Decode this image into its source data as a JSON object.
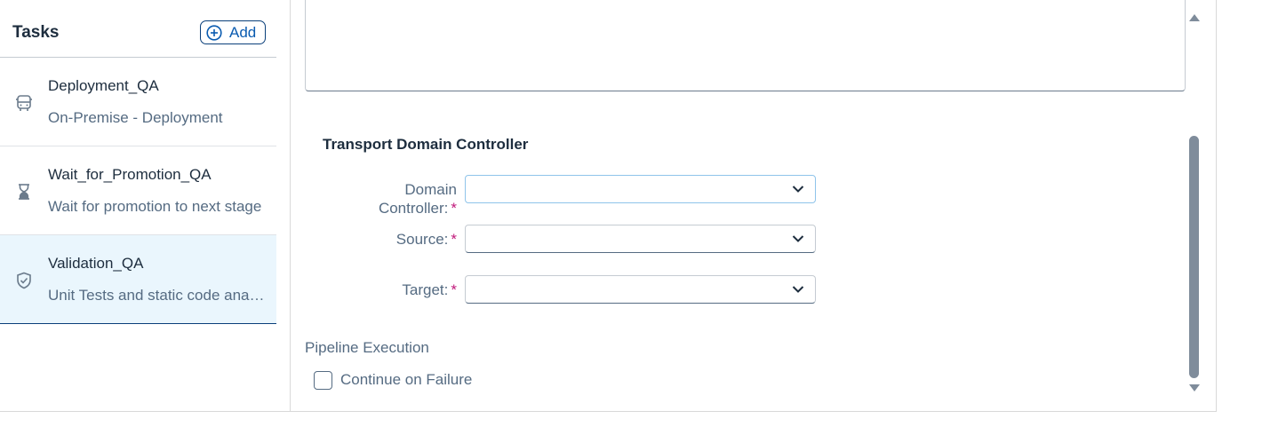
{
  "sidebar": {
    "title": "Tasks",
    "add_label": "Add",
    "tasks": [
      {
        "name": "Deployment_QA",
        "description": "On-Premise - Deployment",
        "icon": "bus-icon"
      },
      {
        "name": "Wait_for_Promotion_QA",
        "description": "Wait for promotion to next stage",
        "icon": "hourglass-icon"
      },
      {
        "name": "Validation_QA",
        "description": "Unit Tests and static code analysis",
        "icon": "shield-check-icon"
      }
    ],
    "selected_index": 2
  },
  "form": {
    "section_title": "Transport Domain Controller",
    "fields": [
      {
        "label_line1": "Domain",
        "label_line2": "Controller:",
        "required": "*",
        "value": ""
      },
      {
        "label": "Source:",
        "required": "*",
        "value": ""
      },
      {
        "label": "Target:",
        "required": "*",
        "value": ""
      }
    ],
    "pipeline_execution": {
      "label": "Pipeline Execution",
      "checkbox_label": "Continue on Failure",
      "checked": false
    }
  },
  "colors": {
    "accent": "#0a5bb0",
    "selected_bg": "#eaf6fd",
    "required": "#c0187a",
    "label": "#556b82"
  }
}
